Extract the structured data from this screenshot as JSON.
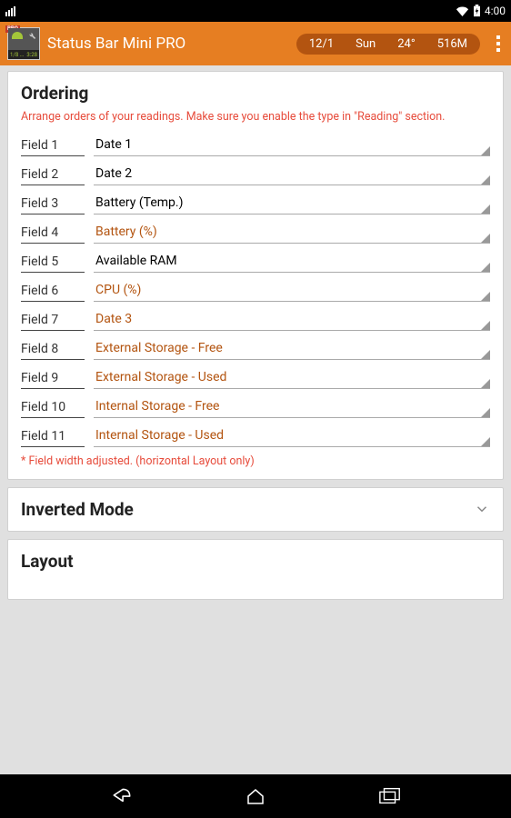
{
  "android_status": {
    "time": "4:00"
  },
  "action_bar": {
    "app_title": "Status Bar Mini PRO",
    "icon_pro": "PRO",
    "icon_bottom_left": "1/8 ...",
    "icon_bottom_right": "3:28",
    "pill": {
      "date": "12/1",
      "day": "Sun",
      "temp": "24°",
      "mem": "516M"
    }
  },
  "ordering": {
    "title": "Ordering",
    "desc": "Arrange orders of your readings. Make sure you enable the type in \"Reading\" section.",
    "fields": [
      {
        "label": "Field 1",
        "value": "Date 1",
        "faded": false
      },
      {
        "label": "Field 2",
        "value": "Date 2",
        "faded": false
      },
      {
        "label": "Field 3",
        "value": "Battery (Temp.)",
        "faded": false
      },
      {
        "label": "Field 4",
        "value": "Battery (%)",
        "faded": true
      },
      {
        "label": "Field 5",
        "value": "Available RAM",
        "faded": false
      },
      {
        "label": "Field 6",
        "value": "CPU (%)",
        "faded": true
      },
      {
        "label": "Field 7",
        "value": "Date 3",
        "faded": true
      },
      {
        "label": "Field 8",
        "value": "External Storage - Free",
        "faded": true
      },
      {
        "label": "Field 9",
        "value": "External Storage - Used",
        "faded": true
      },
      {
        "label": "Field 10",
        "value": "Internal Storage - Free",
        "faded": true
      },
      {
        "label": "Field 11",
        "value": "Internal Storage - Used",
        "faded": true
      }
    ],
    "footnote": "* Field width adjusted. (horizontal Layout only)"
  },
  "inverted": {
    "title": "Inverted Mode"
  },
  "layout": {
    "title": "Layout"
  }
}
